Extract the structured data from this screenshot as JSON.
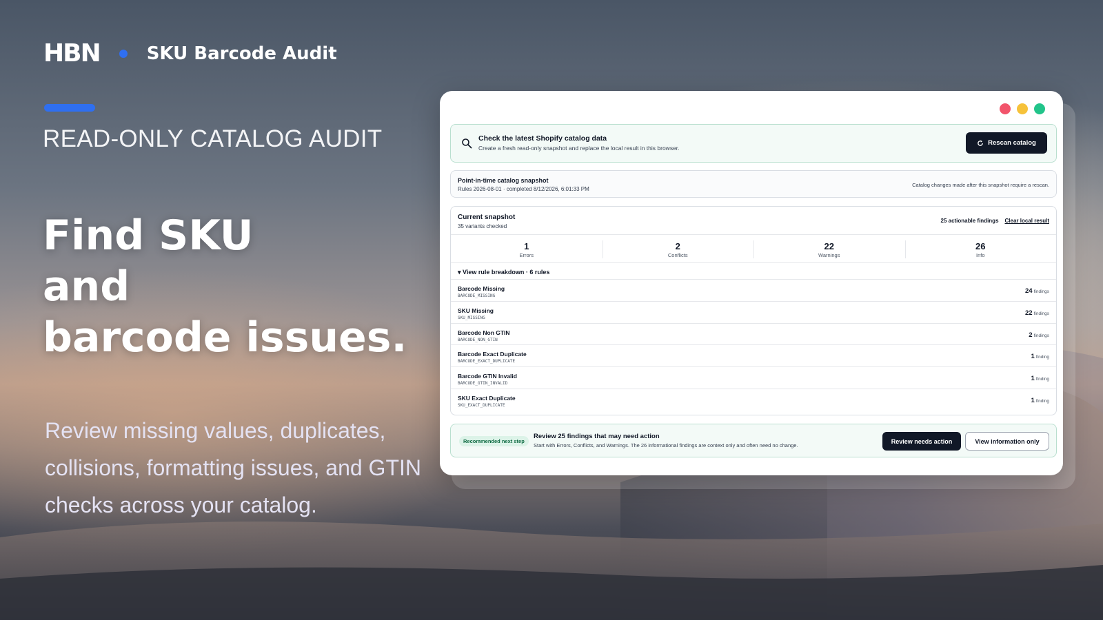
{
  "brand": {
    "logo_text": "HBN",
    "title": "SKU Barcode Audit",
    "accent_color": "#2f6ff0"
  },
  "hero": {
    "eyebrow": "READ-ONLY CATALOG AUDIT",
    "headline_lines": [
      "Find SKU",
      "and",
      "barcode issues."
    ],
    "subtext": "Review missing values, duplicates, collisions, formatting issues, and GTIN checks across your catalog."
  },
  "window": {
    "controls": [
      "close",
      "minimize",
      "maximize"
    ],
    "rescan": {
      "icon": "search-icon",
      "title": "Check the latest Shopify catalog data",
      "description": "Create a fresh read-only snapshot and replace the local result in this browser.",
      "button_label": "Rescan catalog",
      "button_icon": "refresh-icon"
    },
    "snapshot": {
      "title": "Point-in-time catalog snapshot",
      "meta": "Rules 2026-08-01 · completed 8/12/2026, 6:01:33 PM",
      "note": "Catalog changes made after this snapshot require a rescan."
    },
    "current": {
      "title": "Current snapshot",
      "subtitle": "35 variants checked",
      "actionable": "25 actionable findings",
      "clear_label": "Clear local result",
      "stats": [
        {
          "value": "1",
          "label": "Errors"
        },
        {
          "value": "2",
          "label": "Conflicts"
        },
        {
          "value": "22",
          "label": "Warnings"
        },
        {
          "value": "26",
          "label": "Info"
        }
      ],
      "breakdown_label": "▾ View rule breakdown · 6 rules",
      "rules": [
        {
          "name": "Barcode Missing",
          "code": "BARCODE_MISSING",
          "count": "24",
          "unit": "findings"
        },
        {
          "name": "SKU Missing",
          "code": "SKU_MISSING",
          "count": "22",
          "unit": "findings"
        },
        {
          "name": "Barcode Non GTIN",
          "code": "BARCODE_NON_GTIN",
          "count": "2",
          "unit": "findings"
        },
        {
          "name": "Barcode Exact Duplicate",
          "code": "BARCODE_EXACT_DUPLICATE",
          "count": "1",
          "unit": "finding"
        },
        {
          "name": "Barcode GTIN Invalid",
          "code": "BARCODE_GTIN_INVALID",
          "count": "1",
          "unit": "finding"
        },
        {
          "name": "SKU Exact Duplicate",
          "code": "SKU_EXACT_DUPLICATE",
          "count": "1",
          "unit": "finding"
        }
      ]
    },
    "next_step": {
      "badge": "Recommended next step",
      "title": "Review 25 findings that may need action",
      "description": "Start with Errors, Conflicts, and Warnings. The 26 informational findings are context only and often need no change.",
      "primary_label": "Review needs action",
      "secondary_label": "View information only"
    }
  }
}
